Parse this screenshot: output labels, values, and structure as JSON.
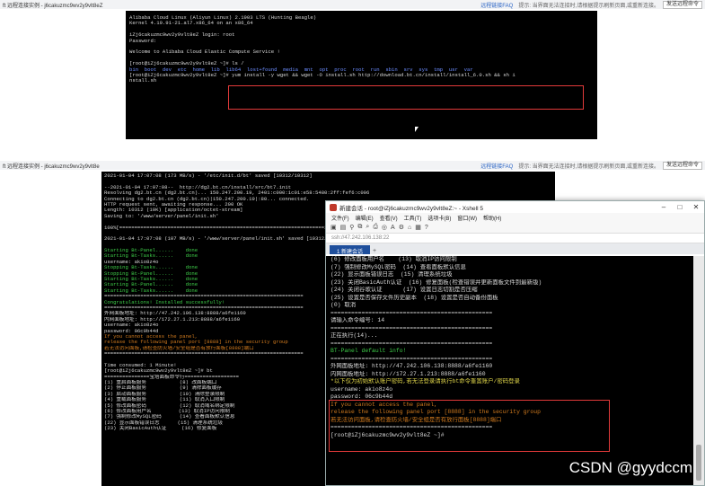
{
  "top_panel": {
    "browser": {
      "title": "ft 远程连接实例 - j6cakuzmc9wv2y9vlt8eZ",
      "faq": "远程链接FAQ",
      "hint": "提示: 当界面无法连接时,请根据提示刷新页面,或重新连接。",
      "right_btn": "发送远程命令"
    },
    "terminal": [
      {
        "t": "Alibaba Cloud Linux (Aliyun Linux) 2.1903 LTS (Hunting Beagle)",
        "c": ""
      },
      {
        "t": "Kernel 4.19.91-21.al7.x86_64 on an x86_64",
        "c": ""
      },
      {
        "t": "",
        "c": ""
      },
      {
        "t": "iZj6cakuzmc9wv2y9vlt8eZ login: root",
        "c": ""
      },
      {
        "t": "Password:",
        "c": ""
      },
      {
        "t": "",
        "c": ""
      },
      {
        "t": "Welcome to Alibaba Cloud Elastic Compute Service !",
        "c": ""
      },
      {
        "t": "",
        "c": ""
      },
      {
        "t": "[root@iZj6cakuzmc9wv2y9vlt8eZ ~]# ls /",
        "c": ""
      },
      {
        "t": "bin  boot  dev  etc  home  lib  lib64  lost+found  media  mnt  opt  proc  root  run  sbin  srv  sys  tmp  usr  var",
        "c": "blue"
      },
      {
        "t": "[root@iZj6cakuzmc9wv2y9vlt8eZ ~]# yum install -y wget && wget -O install.sh http://download.bt.cn/install/install_6.0.sh && sh i",
        "c": ""
      },
      {
        "t": "nstall.sh",
        "c": ""
      }
    ]
  },
  "bottom_panel": {
    "browser": {
      "title": "ft 远程连接实例 - j6cakuzmc9wv2y9vlt8e",
      "faq": "远程链接FAQ",
      "hint": "提示: 当界面无法连接时,请根据提示刷新页面,或重新连接。",
      "right_btn": "发送远程命令"
    },
    "terminal": [
      {
        "t": "2021-01-04 17:07:08 (173 MB/s) - '/etc/init.d/bt' saved [10312/10312]",
        "c": ""
      },
      {
        "t": "",
        "c": ""
      },
      {
        "t": "--2021-01-04 17:07:08--  http://dg2.bt.cn/install/src/bt7.init",
        "c": ""
      },
      {
        "t": "Resolving dg2.bt.cn (dg2.bt.cn)... 150.247.200.19, 2401:c000:1c01:e58:5480:2ff:fef6:c006",
        "c": ""
      },
      {
        "t": "Connecting to dg2.bt.cn (dg2.bt.cn)|150.247.200.19|:80... connected.",
        "c": ""
      },
      {
        "t": "HTTP request sent, awaiting response... 200 OK",
        "c": ""
      },
      {
        "t": "Length: 10312 (10K) [application/octet-stream]",
        "c": ""
      },
      {
        "t": "Saving to: '/www/server/panel/init.sh'",
        "c": ""
      },
      {
        "t": "",
        "c": ""
      },
      {
        "t": "100%[====================================================================>] 10,312",
        "c": ""
      },
      {
        "t": "",
        "c": ""
      },
      {
        "t": "2021-01-04 17:07:08 (107 MB/s) - '/www/server/panel/init.sh' saved [10312/10312]",
        "c": ""
      },
      {
        "t": "",
        "c": ""
      },
      {
        "t": "Starting Bt-Panel......    done",
        "c": "green"
      },
      {
        "t": "Starting Bt-Tasks......    done",
        "c": "green"
      },
      {
        "t": "username: akio8z4o",
        "c": ""
      },
      {
        "t": "Stopping Bt-Tasks......    done",
        "c": "green"
      },
      {
        "t": "Stopping Bt-Panel......    done",
        "c": "green"
      },
      {
        "t": "Starting Bt-Tasks......    done",
        "c": "green"
      },
      {
        "t": "Starting Bt-Panel......    done",
        "c": "green"
      },
      {
        "t": "Starting Bt-Tasks......    done",
        "c": "green"
      },
      {
        "t": "==================================================================",
        "c": ""
      },
      {
        "t": "Congratulations! Installed successfully!",
        "c": "green"
      },
      {
        "t": "==================================================================",
        "c": ""
      },
      {
        "t": "外网面板地址: http://47.242.106.138:8888/a6fe1160",
        "c": ""
      },
      {
        "t": "内网面板地址: http://172.27.1.213:8888/a6fe1160",
        "c": ""
      },
      {
        "t": "username: akio8z4o",
        "c": ""
      },
      {
        "t": "password: 06c9b44d",
        "c": ""
      },
      {
        "t": "If you cannot access the panel,",
        "c": "org"
      },
      {
        "t": "release the following panel port [8888] in the security group",
        "c": "org"
      },
      {
        "t": "若无法访问面板,请检查防火墙/安全组是否有放行面板[8888]端口",
        "c": "org"
      },
      {
        "t": "==================================================================",
        "c": ""
      },
      {
        "t": "",
        "c": ""
      },
      {
        "t": "Time consumed: 1 Minute!",
        "c": ""
      },
      {
        "t": "[root@iZj6cakuzmc9wv2y9vlt8eZ ~]# bt",
        "c": ""
      },
      {
        "t": "===============宝塔面板命令行==================",
        "c": ""
      },
      {
        "t": "(1) 重启面板服务           (8) 改面板端口",
        "c": ""
      },
      {
        "t": "(2) 停止面板服务           (9) 清除面板缓存",
        "c": ""
      },
      {
        "t": "(3) 启动面板服务           (10) 清除登录限制",
        "c": ""
      },
      {
        "t": "(4) 重载面板服务           (11) 取消入口限制",
        "c": ""
      },
      {
        "t": "(5) 修改面板密码           (12) 取消域名绑定限制",
        "c": ""
      },
      {
        "t": "(6) 修改面板用户名         (13) 取消IP访问限制",
        "c": ""
      },
      {
        "t": "(7) 强制修改MySQL密码      (14) 查看面板默认信息",
        "c": ""
      },
      {
        "t": "(22) 显示面板错误日志      (15) 清理系统垃圾",
        "c": ""
      },
      {
        "t": "(23) 关闭BasicAuth认证     (16) 修复面板",
        "c": ""
      }
    ]
  },
  "xshell": {
    "title": "新建会话 - root@iZj6cakuzmc9wv2y9vlt8eZ:~ - Xshell 5",
    "menu": [
      "文件(F)",
      "编辑(E)",
      "查看(V)",
      "工具(T)",
      "选项卡(B)",
      "窗口(W)",
      "帮助(H)"
    ],
    "address": "ssh://47.242.106.138:22",
    "tab": "1 新建会话",
    "terminal": [
      {
        "t": "(6) 修改面板用户名    (13) 取消IP访问限制",
        "c": ""
      },
      {
        "t": "(7) 强制修改MySQL密码  (14) 查看面板默认信息",
        "c": ""
      },
      {
        "t": "(22) 显示面板错误日志  (15) 清理系统垃圾",
        "c": ""
      },
      {
        "t": "(23) 关闭BasicAuth认证  (16) 修复面板(检查错误并更新面板文件到最新版)",
        "c": ""
      },
      {
        "t": "(24) 关闭谷歌认证      (17) 设置日志切割是否压缩",
        "c": ""
      },
      {
        "t": "(25) 设置是否保存文件历史副本  (18) 设置是否自动备份面板",
        "c": ""
      },
      {
        "t": "(0) 取消",
        "c": ""
      },
      {
        "t": "===============================================",
        "c": ""
      },
      {
        "t": "请输入命令编号: 14",
        "c": ""
      },
      {
        "t": "===============================================",
        "c": ""
      },
      {
        "t": "正在执行(14)...",
        "c": ""
      },
      {
        "t": "===============================================",
        "c": ""
      },
      {
        "t": "BT-Panel default info!",
        "c": "green"
      },
      {
        "t": "===============================================",
        "c": ""
      },
      {
        "t": "外网面板地址: http://47.242.106.138:8888/a6fe1160",
        "c": ""
      },
      {
        "t": "内网面板地址: http://172.27.1.213:8888/a6fe1160",
        "c": ""
      },
      {
        "t": "*以下仅为初始默认账户密码,若无法登录请执行bt命令重置账户/密码登录",
        "c": "yel"
      },
      {
        "t": "username: akio8z4o",
        "c": ""
      },
      {
        "t": "password: 06c9b44d",
        "c": ""
      },
      {
        "t": "If you cannot access the panel,",
        "c": "org"
      },
      {
        "t": "release the following panel port [8888] in the security group",
        "c": "org"
      },
      {
        "t": "若无法访问面板,请检查防火墙/安全组是否有放行面板[8888]端口",
        "c": "org"
      },
      {
        "t": "===============================================",
        "c": ""
      },
      {
        "t": "[root@iZj6cakuzmc9wv2y9vlt8eZ ~]# ",
        "c": ""
      }
    ]
  },
  "watermark": "CSDN @gyydccm"
}
